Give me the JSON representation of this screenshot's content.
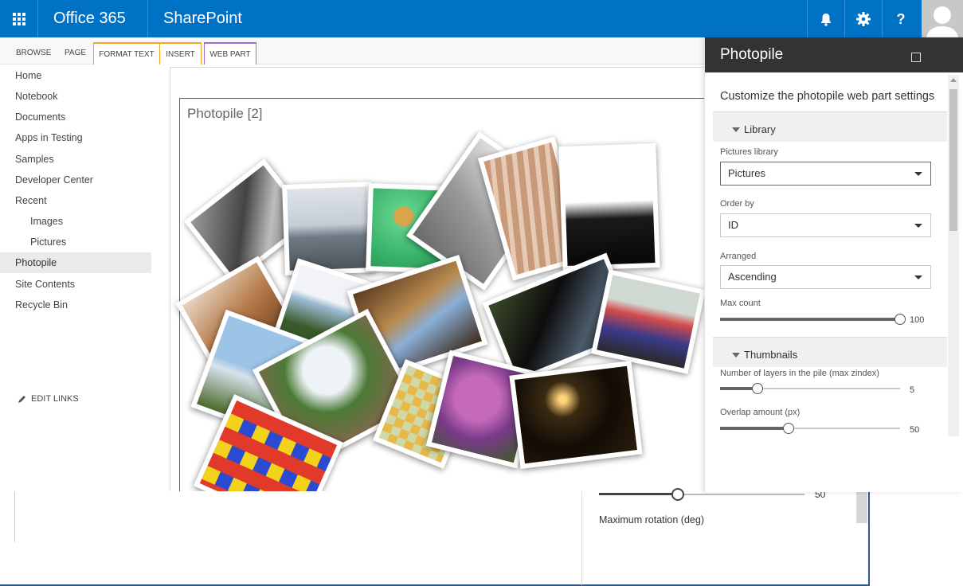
{
  "suite": {
    "brand": "Office 365",
    "app": "SharePoint"
  },
  "ribbon": {
    "tabs": [
      "BROWSE",
      "PAGE",
      "FORMAT TEXT",
      "INSERT",
      "WEB PART"
    ]
  },
  "nav": {
    "items": [
      {
        "label": "Home",
        "level": 0
      },
      {
        "label": "Notebook",
        "level": 0
      },
      {
        "label": "Documents",
        "level": 0
      },
      {
        "label": "Apps in Testing",
        "level": 0
      },
      {
        "label": "Samples",
        "level": 0
      },
      {
        "label": "Developer Center",
        "level": 0
      },
      {
        "label": "Recent",
        "level": 0
      },
      {
        "label": "Images",
        "level": 1
      },
      {
        "label": "Pictures",
        "level": 1
      },
      {
        "label": "Photopile",
        "level": 0,
        "selected": true
      },
      {
        "label": "Site Contents",
        "level": 0
      },
      {
        "label": "Recycle Bin",
        "level": 0
      }
    ],
    "edit_links": "EDIT LINKS"
  },
  "webpart": {
    "title": "Photopile [2]"
  },
  "panel": {
    "title": "Photopile",
    "description": "Customize the photopile web part settings",
    "library_section": "Library",
    "pictures_library_label": "Pictures library",
    "pictures_library_value": "Pictures",
    "order_by_label": "Order by",
    "order_by_value": "ID",
    "arranged_label": "Arranged",
    "arranged_value": "Ascending",
    "max_count_label": "Max count",
    "max_count_value": "100",
    "thumbnails_section": "Thumbnails",
    "layers_label": "Number of layers in the pile (max zindex)",
    "layers_value": "5",
    "overlap_label": "Overlap amount (px)",
    "overlap_value": "50"
  },
  "background_window": {
    "slider_value": "50",
    "label": "Maximum rotation (deg)"
  },
  "colors": {
    "suite_blue": "#0072c6",
    "panel_header": "#333333",
    "format_tab": "#f5a623",
    "webpart_tab": "#9b6fd1"
  }
}
